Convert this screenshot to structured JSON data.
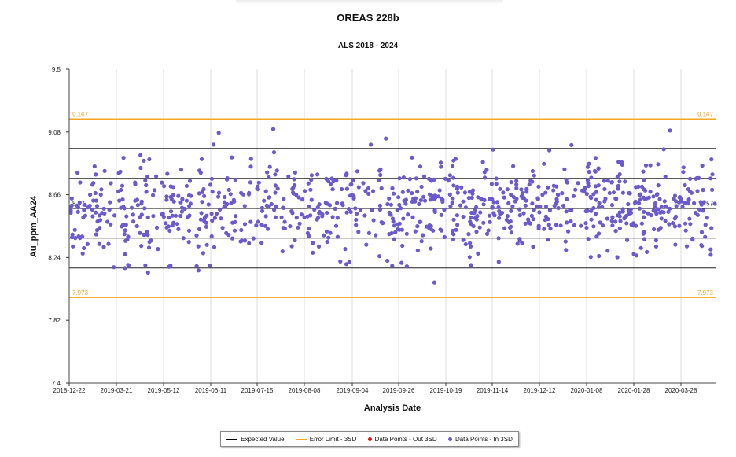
{
  "chart_data": {
    "type": "scatter",
    "title": "OREAS 228b",
    "subtitle": "ALS 2018 - 2024",
    "xlabel": "Analysis Date",
    "ylabel": "Au_ppm_AA24",
    "ylim": [
      7.4,
      9.5
    ],
    "y_ticks": [
      "7.4",
      "7.82",
      "8.24",
      "8.66",
      "9.08",
      "9.5"
    ],
    "x_ticks": [
      "2018-12-22",
      "2019-03-21",
      "2019-05-12",
      "2019-06-11",
      "2019-07-15",
      "2019-08-08",
      "2019-09-04",
      "2019-09-26",
      "2019-10-19",
      "2019-11-14",
      "2019-12-12",
      "2020-01-08",
      "2020-01-28",
      "2020-03-28"
    ],
    "grid": true,
    "expected_value": 8.57,
    "expected_value_label": "8.57",
    "error_limit_upper": 9.167,
    "error_limit_upper_label": "9.167",
    "error_limit_lower": 7.973,
    "error_limit_lower_label": "7.973",
    "sd_lines": [
      8.37,
      8.17,
      8.77,
      8.97
    ],
    "legend_position": "bottom",
    "legend": [
      {
        "label": "Expected Value",
        "kind": "line",
        "color": "#000000"
      },
      {
        "label": "Error Limit - 3SD",
        "kind": "line",
        "color": "#f5a623"
      },
      {
        "label": "Data Points - Out 3SD",
        "kind": "dot",
        "color": "#e01010"
      },
      {
        "label": "Data Points - In 3SD",
        "kind": "dot",
        "color": "#6a5acd"
      }
    ],
    "series": [
      {
        "name": "Data Points - In 3SD",
        "color": "#6a5acd",
        "points": [
          [
            0.0,
            8.54
          ],
          [
            0.1,
            8.62
          ],
          [
            0.12,
            8.14
          ],
          [
            0.28,
            8.9
          ],
          [
            0.3,
            8.62
          ],
          [
            0.4,
            8.75
          ],
          [
            0.5,
            8.5
          ],
          [
            0.52,
            8.6
          ],
          [
            0.6,
            8.7
          ],
          [
            0.62,
            8.48
          ],
          [
            0.7,
            8.65
          ],
          [
            0.8,
            8.55
          ],
          [
            0.82,
            8.4
          ],
          [
            0.9,
            8.68
          ],
          [
            1.0,
            8.6
          ],
          [
            0.15,
            8.8
          ],
          [
            0.18,
            8.62
          ],
          [
            0.22,
            8.68
          ],
          [
            0.24,
            8.58
          ],
          [
            0.25,
            8.91
          ],
          [
            0.35,
            8.66
          ],
          [
            0.45,
            8.56
          ],
          [
            0.55,
            8.62
          ],
          [
            0.65,
            8.52
          ],
          [
            0.75,
            8.72
          ],
          [
            0.85,
            8.7
          ],
          [
            0.95,
            8.58
          ],
          [
            0.03,
            8.66
          ],
          [
            0.06,
            8.56
          ],
          [
            0.08,
            8.72
          ]
        ]
      }
    ],
    "scatter_generation_note_removed": true
  }
}
